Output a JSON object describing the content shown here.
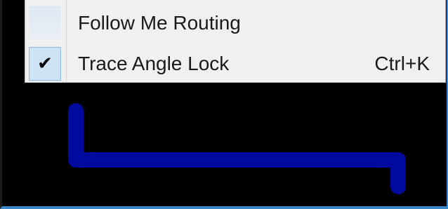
{
  "menu": {
    "items": [
      {
        "label": "Follow Me Routing",
        "checked": false,
        "shortcut": ""
      },
      {
        "label": "Trace Angle Lock",
        "checked": true,
        "shortcut": "Ctrl+K",
        "check_icon": "checkmark-icon"
      }
    ]
  },
  "trace": {
    "color": "#000a9c"
  },
  "colors": {
    "canvas_background": "#000000",
    "menu_background": "#f0f0f0",
    "window_border": "#3a86c8"
  }
}
